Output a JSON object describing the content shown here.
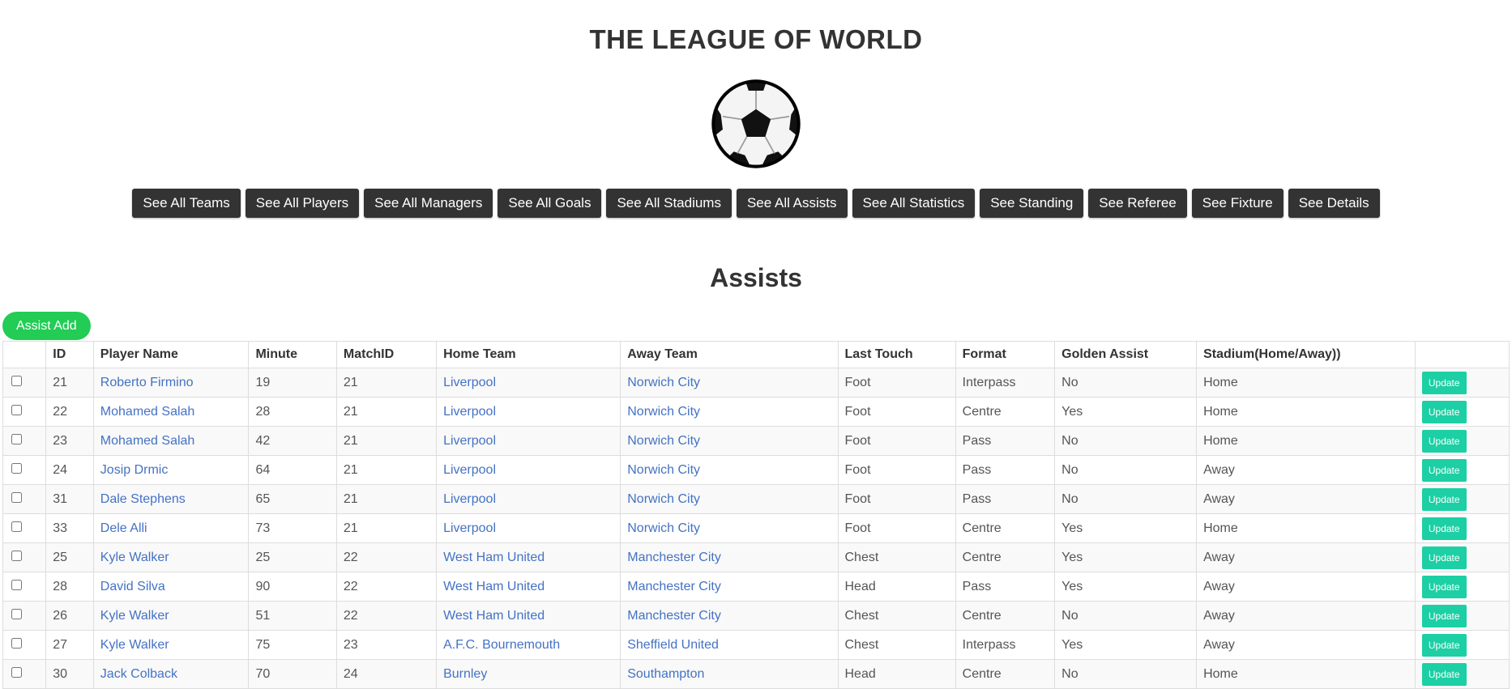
{
  "header": {
    "title": "THE LEAGUE OF WORLD",
    "logo_icon": "soccer-ball-icon"
  },
  "nav": [
    "See All Teams",
    "See All Players",
    "See All Managers",
    "See All Goals",
    "See All Stadiums",
    "See All Assists",
    "See All Statistics",
    "See Standing",
    "See Referee",
    "See Fixture",
    "See Details"
  ],
  "section": {
    "title": "Assists",
    "add_label": "Assist Add"
  },
  "colors": {
    "nav_button": "#333333",
    "add_button": "#22cc55",
    "update_button": "#1ccfa4",
    "link": "#4472c4"
  },
  "table": {
    "columns": [
      "",
      "ID",
      "Player Name",
      "Minute",
      "MatchID",
      "Home Team",
      "Away Team",
      "Last Touch",
      "Format",
      "Golden Assist",
      "Stadium(Home/Away))",
      ""
    ],
    "update_label": "Update",
    "rows": [
      {
        "id": "21",
        "player": "Roberto Firmino",
        "minute": "19",
        "match": "21",
        "home": "Liverpool",
        "away": "Norwich City",
        "touch": "Foot",
        "format": "Interpass",
        "golden": "No",
        "stadium": "Home"
      },
      {
        "id": "22",
        "player": "Mohamed Salah",
        "minute": "28",
        "match": "21",
        "home": "Liverpool",
        "away": "Norwich City",
        "touch": "Foot",
        "format": "Centre",
        "golden": "Yes",
        "stadium": "Home"
      },
      {
        "id": "23",
        "player": "Mohamed Salah",
        "minute": "42",
        "match": "21",
        "home": "Liverpool",
        "away": "Norwich City",
        "touch": "Foot",
        "format": "Pass",
        "golden": "No",
        "stadium": "Home"
      },
      {
        "id": "24",
        "player": "Josip Drmic",
        "minute": "64",
        "match": "21",
        "home": "Liverpool",
        "away": "Norwich City",
        "touch": "Foot",
        "format": "Pass",
        "golden": "No",
        "stadium": "Away"
      },
      {
        "id": "31",
        "player": "Dale Stephens",
        "minute": "65",
        "match": "21",
        "home": "Liverpool",
        "away": "Norwich City",
        "touch": "Foot",
        "format": "Pass",
        "golden": "No",
        "stadium": "Away"
      },
      {
        "id": "33",
        "player": "Dele Alli",
        "minute": "73",
        "match": "21",
        "home": "Liverpool",
        "away": "Norwich City",
        "touch": "Foot",
        "format": "Centre",
        "golden": "Yes",
        "stadium": "Home"
      },
      {
        "id": "25",
        "player": "Kyle Walker",
        "minute": "25",
        "match": "22",
        "home": "West Ham United",
        "away": "Manchester City",
        "touch": "Chest",
        "format": "Centre",
        "golden": "Yes",
        "stadium": "Away"
      },
      {
        "id": "28",
        "player": "David Silva",
        "minute": "90",
        "match": "22",
        "home": "West Ham United",
        "away": "Manchester City",
        "touch": "Head",
        "format": "Pass",
        "golden": "Yes",
        "stadium": "Away"
      },
      {
        "id": "26",
        "player": "Kyle Walker",
        "minute": "51",
        "match": "22",
        "home": "West Ham United",
        "away": "Manchester City",
        "touch": "Chest",
        "format": "Centre",
        "golden": "No",
        "stadium": "Away"
      },
      {
        "id": "27",
        "player": "Kyle Walker",
        "minute": "75",
        "match": "23",
        "home": "A.F.C. Bournemouth",
        "away": "Sheffield United",
        "touch": "Chest",
        "format": "Interpass",
        "golden": "Yes",
        "stadium": "Away"
      },
      {
        "id": "30",
        "player": "Jack Colback",
        "minute": "70",
        "match": "24",
        "home": "Burnley",
        "away": "Southampton",
        "touch": "Head",
        "format": "Centre",
        "golden": "No",
        "stadium": "Home"
      }
    ]
  }
}
